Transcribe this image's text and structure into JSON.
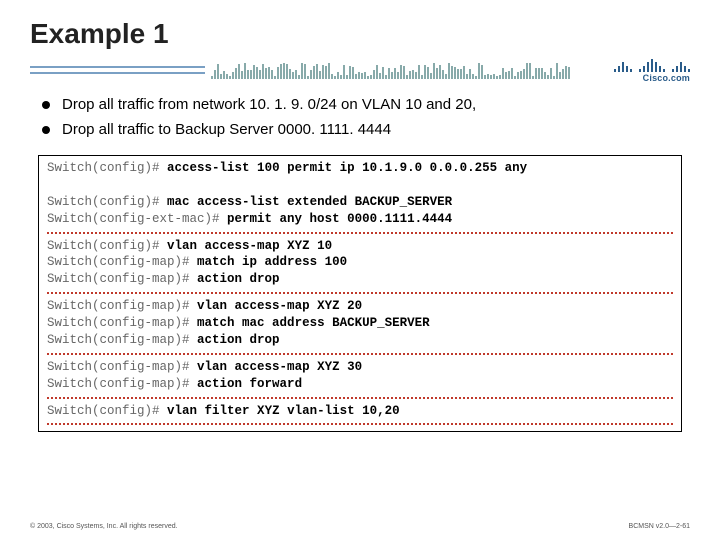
{
  "title": "Example 1",
  "bullets": [
    "Drop all traffic from network 10. 1. 9. 0/24 on VLAN 10 and 20,",
    "Drop all traffic to Backup Server 0000. 1111. 4444"
  ],
  "logo_text": "Cisco.com",
  "code": {
    "b1": [
      {
        "prompt": "Switch(config)#",
        "cmd": "access-list 100 permit ip 10.1.9.0 0.0.0.255 any"
      }
    ],
    "b2": [
      {
        "prompt": "Switch(config)#",
        "cmd": "mac access-list extended BACKUP_SERVER"
      },
      {
        "prompt": "Switch(config-ext-mac)#",
        "cmd": "permit any host 0000.1111.4444"
      }
    ],
    "b3": [
      {
        "prompt": "Switch(config)#",
        "cmd": "vlan access-map XYZ 10"
      },
      {
        "prompt": "Switch(config-map)#",
        "cmd": "match ip address 100"
      },
      {
        "prompt": "Switch(config-map)#",
        "cmd": "action drop"
      }
    ],
    "b4": [
      {
        "prompt": "Switch(config-map)#",
        "cmd": "vlan access-map XYZ 20"
      },
      {
        "prompt": "Switch(config-map)#",
        "cmd": "match mac address BACKUP_SERVER"
      },
      {
        "prompt": "Switch(config-map)#",
        "cmd": "action drop"
      }
    ],
    "b5": [
      {
        "prompt": "Switch(config-map)#",
        "cmd": "vlan access-map XYZ 30"
      },
      {
        "prompt": "Switch(config-map)#",
        "cmd": "action forward"
      }
    ],
    "b6": [
      {
        "prompt": "Switch(config)#",
        "cmd": "vlan filter XYZ vlan-list 10,20"
      }
    ]
  },
  "footer_left": "© 2003, Cisco Systems, Inc. All rights reserved.",
  "footer_right": "BCMSN v2.0—2-61"
}
